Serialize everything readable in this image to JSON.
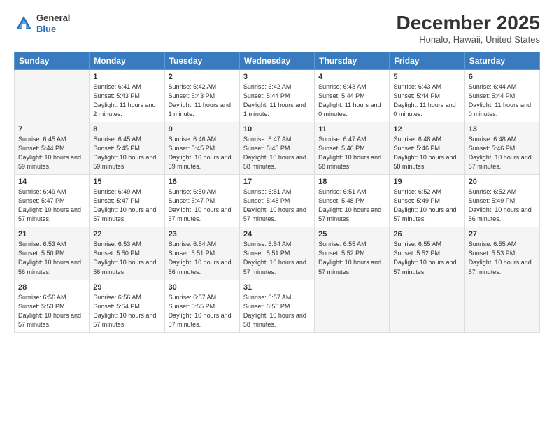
{
  "header": {
    "logo_line1": "General",
    "logo_line2": "Blue",
    "title": "December 2025",
    "subtitle": "Honalo, Hawaii, United States"
  },
  "columns": [
    "Sunday",
    "Monday",
    "Tuesday",
    "Wednesday",
    "Thursday",
    "Friday",
    "Saturday"
  ],
  "weeks": [
    [
      {
        "day": "",
        "sunrise": "",
        "sunset": "",
        "daylight": ""
      },
      {
        "day": "1",
        "sunrise": "Sunrise: 6:41 AM",
        "sunset": "Sunset: 5:43 PM",
        "daylight": "Daylight: 11 hours and 2 minutes."
      },
      {
        "day": "2",
        "sunrise": "Sunrise: 6:42 AM",
        "sunset": "Sunset: 5:43 PM",
        "daylight": "Daylight: 11 hours and 1 minute."
      },
      {
        "day": "3",
        "sunrise": "Sunrise: 6:42 AM",
        "sunset": "Sunset: 5:44 PM",
        "daylight": "Daylight: 11 hours and 1 minute."
      },
      {
        "day": "4",
        "sunrise": "Sunrise: 6:43 AM",
        "sunset": "Sunset: 5:44 PM",
        "daylight": "Daylight: 11 hours and 0 minutes."
      },
      {
        "day": "5",
        "sunrise": "Sunrise: 6:43 AM",
        "sunset": "Sunset: 5:44 PM",
        "daylight": "Daylight: 11 hours and 0 minutes."
      },
      {
        "day": "6",
        "sunrise": "Sunrise: 6:44 AM",
        "sunset": "Sunset: 5:44 PM",
        "daylight": "Daylight: 11 hours and 0 minutes."
      }
    ],
    [
      {
        "day": "7",
        "sunrise": "Sunrise: 6:45 AM",
        "sunset": "Sunset: 5:44 PM",
        "daylight": "Daylight: 10 hours and 59 minutes."
      },
      {
        "day": "8",
        "sunrise": "Sunrise: 6:45 AM",
        "sunset": "Sunset: 5:45 PM",
        "daylight": "Daylight: 10 hours and 59 minutes."
      },
      {
        "day": "9",
        "sunrise": "Sunrise: 6:46 AM",
        "sunset": "Sunset: 5:45 PM",
        "daylight": "Daylight: 10 hours and 59 minutes."
      },
      {
        "day": "10",
        "sunrise": "Sunrise: 6:47 AM",
        "sunset": "Sunset: 5:45 PM",
        "daylight": "Daylight: 10 hours and 58 minutes."
      },
      {
        "day": "11",
        "sunrise": "Sunrise: 6:47 AM",
        "sunset": "Sunset: 5:46 PM",
        "daylight": "Daylight: 10 hours and 58 minutes."
      },
      {
        "day": "12",
        "sunrise": "Sunrise: 6:48 AM",
        "sunset": "Sunset: 5:46 PM",
        "daylight": "Daylight: 10 hours and 58 minutes."
      },
      {
        "day": "13",
        "sunrise": "Sunrise: 6:48 AM",
        "sunset": "Sunset: 5:46 PM",
        "daylight": "Daylight: 10 hours and 57 minutes."
      }
    ],
    [
      {
        "day": "14",
        "sunrise": "Sunrise: 6:49 AM",
        "sunset": "Sunset: 5:47 PM",
        "daylight": "Daylight: 10 hours and 57 minutes."
      },
      {
        "day": "15",
        "sunrise": "Sunrise: 6:49 AM",
        "sunset": "Sunset: 5:47 PM",
        "daylight": "Daylight: 10 hours and 57 minutes."
      },
      {
        "day": "16",
        "sunrise": "Sunrise: 6:50 AM",
        "sunset": "Sunset: 5:47 PM",
        "daylight": "Daylight: 10 hours and 57 minutes."
      },
      {
        "day": "17",
        "sunrise": "Sunrise: 6:51 AM",
        "sunset": "Sunset: 5:48 PM",
        "daylight": "Daylight: 10 hours and 57 minutes."
      },
      {
        "day": "18",
        "sunrise": "Sunrise: 6:51 AM",
        "sunset": "Sunset: 5:48 PM",
        "daylight": "Daylight: 10 hours and 57 minutes."
      },
      {
        "day": "19",
        "sunrise": "Sunrise: 6:52 AM",
        "sunset": "Sunset: 5:49 PM",
        "daylight": "Daylight: 10 hours and 57 minutes."
      },
      {
        "day": "20",
        "sunrise": "Sunrise: 6:52 AM",
        "sunset": "Sunset: 5:49 PM",
        "daylight": "Daylight: 10 hours and 56 minutes."
      }
    ],
    [
      {
        "day": "21",
        "sunrise": "Sunrise: 6:53 AM",
        "sunset": "Sunset: 5:50 PM",
        "daylight": "Daylight: 10 hours and 56 minutes."
      },
      {
        "day": "22",
        "sunrise": "Sunrise: 6:53 AM",
        "sunset": "Sunset: 5:50 PM",
        "daylight": "Daylight: 10 hours and 56 minutes."
      },
      {
        "day": "23",
        "sunrise": "Sunrise: 6:54 AM",
        "sunset": "Sunset: 5:51 PM",
        "daylight": "Daylight: 10 hours and 56 minutes."
      },
      {
        "day": "24",
        "sunrise": "Sunrise: 6:54 AM",
        "sunset": "Sunset: 5:51 PM",
        "daylight": "Daylight: 10 hours and 57 minutes."
      },
      {
        "day": "25",
        "sunrise": "Sunrise: 6:55 AM",
        "sunset": "Sunset: 5:52 PM",
        "daylight": "Daylight: 10 hours and 57 minutes."
      },
      {
        "day": "26",
        "sunrise": "Sunrise: 6:55 AM",
        "sunset": "Sunset: 5:52 PM",
        "daylight": "Daylight: 10 hours and 57 minutes."
      },
      {
        "day": "27",
        "sunrise": "Sunrise: 6:55 AM",
        "sunset": "Sunset: 5:53 PM",
        "daylight": "Daylight: 10 hours and 57 minutes."
      }
    ],
    [
      {
        "day": "28",
        "sunrise": "Sunrise: 6:56 AM",
        "sunset": "Sunset: 5:53 PM",
        "daylight": "Daylight: 10 hours and 57 minutes."
      },
      {
        "day": "29",
        "sunrise": "Sunrise: 6:56 AM",
        "sunset": "Sunset: 5:54 PM",
        "daylight": "Daylight: 10 hours and 57 minutes."
      },
      {
        "day": "30",
        "sunrise": "Sunrise: 6:57 AM",
        "sunset": "Sunset: 5:55 PM",
        "daylight": "Daylight: 10 hours and 57 minutes."
      },
      {
        "day": "31",
        "sunrise": "Sunrise: 6:57 AM",
        "sunset": "Sunset: 5:55 PM",
        "daylight": "Daylight: 10 hours and 58 minutes."
      },
      {
        "day": "",
        "sunrise": "",
        "sunset": "",
        "daylight": ""
      },
      {
        "day": "",
        "sunrise": "",
        "sunset": "",
        "daylight": ""
      },
      {
        "day": "",
        "sunrise": "",
        "sunset": "",
        "daylight": ""
      }
    ]
  ]
}
